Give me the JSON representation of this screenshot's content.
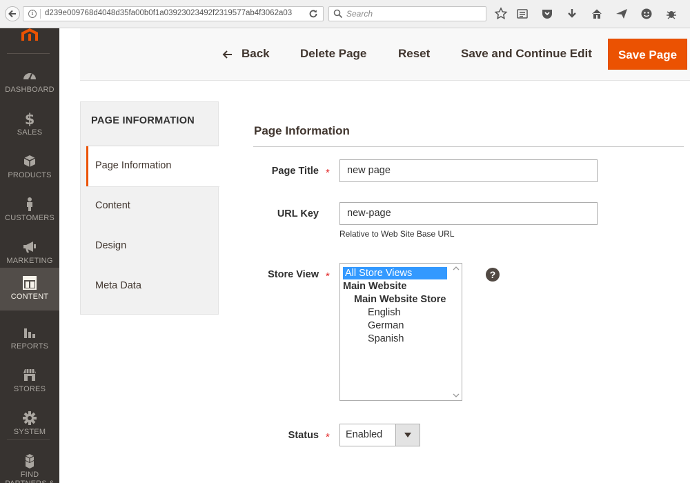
{
  "browser": {
    "url": "d239e009768d4048d35fa00b0f1a03923023492f2319577ab4f3062a03",
    "search_placeholder": "Search"
  },
  "admin_nav": {
    "items": [
      {
        "label": "DASHBOARD",
        "icon": "dashboard-icon"
      },
      {
        "label": "SALES",
        "icon": "dollar-icon"
      },
      {
        "label": "PRODUCTS",
        "icon": "cube-icon"
      },
      {
        "label": "CUSTOMERS",
        "icon": "person-icon"
      },
      {
        "label": "MARKETING",
        "icon": "megaphone-icon"
      },
      {
        "label": "CONTENT",
        "icon": "layout-icon",
        "active": true
      },
      {
        "label": "REPORTS",
        "icon": "bar-chart-icon"
      },
      {
        "label": "STORES",
        "icon": "storefront-icon"
      },
      {
        "label": "SYSTEM",
        "icon": "gear-icon"
      },
      {
        "label": "FIND PARTNERS &",
        "icon": "boxes-icon"
      }
    ]
  },
  "actions": {
    "back": "Back",
    "delete": "Delete Page",
    "reset": "Reset",
    "save_continue": "Save and Continue Edit",
    "save": "Save Page"
  },
  "tabs": {
    "title": "PAGE INFORMATION",
    "items": [
      "Page Information",
      "Content",
      "Design",
      "Meta Data"
    ]
  },
  "form": {
    "section_title": "Page Information",
    "page_title_label": "Page Title",
    "page_title_value": "new page",
    "url_key_label": "URL Key",
    "url_key_value": "new-page",
    "url_key_note": "Relative to Web Site Base URL",
    "store_view_label": "Store View",
    "store_view_options": [
      "All Store Views",
      "Main Website",
      "Main Website Store",
      "English",
      "German",
      "Spanish"
    ],
    "store_view_selected": "All Store Views",
    "help_symbol": "?",
    "status_label": "Status",
    "status_value": "Enabled",
    "required_marker": "*"
  },
  "colors": {
    "accent": "#eb5202",
    "sidebar_bg": "#373330",
    "sidebar_active": "#524d49",
    "selection": "#3399ff"
  }
}
